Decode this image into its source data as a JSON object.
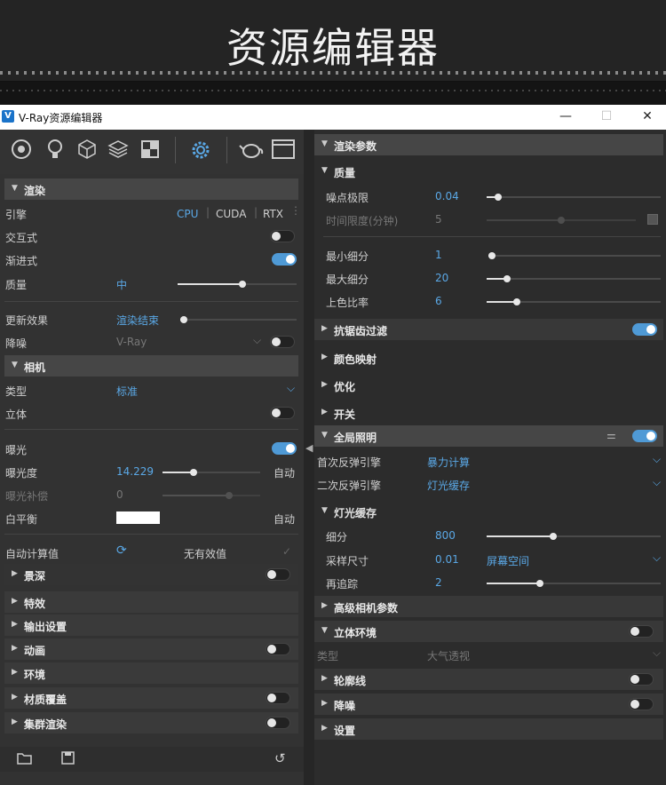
{
  "banner": {
    "title": "资源编辑器"
  },
  "window": {
    "title": "V-Ray资源编辑器",
    "logo": "V",
    "min": "—",
    "max": "☐",
    "close": "✕"
  },
  "toolbar": {
    "icons": [
      "materials-icon",
      "lights-icon",
      "geometry-icon",
      "layers-icon",
      "textures-icon",
      "settings-icon",
      "teapot-render-icon",
      "render-window-icon"
    ]
  },
  "left": {
    "render": {
      "header": "渲染",
      "engine_label": "引擎",
      "cpu": "CPU",
      "cuda": "CUDA",
      "rtx": "RTX",
      "interactive_label": "交互式",
      "progressive_label": "渐进式",
      "quality_label": "质量",
      "quality_value": "中",
      "quality_level": 0.55,
      "update_label": "更新效果",
      "update_value": "渲染结束",
      "update_level": 0.0,
      "denoise_label": "降噪",
      "denoise_value": "V-Ray"
    },
    "camera": {
      "header": "相机",
      "type_label": "类型",
      "type_value": "标准",
      "stereo_label": "立体",
      "exposure_label": "曝光",
      "ev_label": "曝光度",
      "ev_value": "14.229",
      "ev_auto": "自动",
      "ev_level": 0.3,
      "comp_label": "曝光补偿",
      "comp_value": "0",
      "comp_level": 0.7,
      "wb_label": "白平衡",
      "wb_auto": "自动",
      "wb_color": "#ffffff",
      "autocalc_label": "自动计算值",
      "autocalc_status": "无有效值"
    },
    "sections": [
      {
        "label": "景深",
        "toggle": true
      },
      {
        "label": "特效",
        "toggle": false
      },
      {
        "label": "输出设置",
        "toggle": false
      },
      {
        "label": "动画",
        "toggle": true
      },
      {
        "label": "环境",
        "toggle": false
      },
      {
        "label": "材质覆盖",
        "toggle": true
      },
      {
        "label": "集群渲染",
        "toggle": true
      }
    ]
  },
  "right": {
    "header": "渲染参数",
    "quality": {
      "header": "质量",
      "noise_label": "噪点极限",
      "noise_value": "0.04",
      "noise_level": 0.05,
      "time_label": "时间限度(分钟)",
      "time_value": "5",
      "time_level": 0.5,
      "minsub_label": "最小细分",
      "minsub_value": "1",
      "minsub_level": 0.0,
      "maxsub_label": "最大细分",
      "maxsub_value": "20",
      "maxsub_level": 0.1,
      "shade_label": "上色比率",
      "shade_value": "6",
      "shade_level": 0.16
    },
    "aa": "抗锯齿过滤",
    "color_mapping": "颜色映射",
    "optimize": "优化",
    "switches": "开关",
    "gi": {
      "header": "全局照明",
      "primary_label": "首次反弹引擎",
      "primary_value": "暴力计算",
      "secondary_label": "二次反弹引擎",
      "secondary_value": "灯光缓存"
    },
    "lightcache": {
      "header": "灯光缓存",
      "subdiv_label": "细分",
      "subdiv_value": "800",
      "subdiv_level": 0.38,
      "sample_label": "采样尺寸",
      "sample_value": "0.01",
      "sample_mode": "屏幕空间",
      "retrace_label": "再追踪",
      "retrace_value": "2",
      "retrace_level": 0.3
    },
    "adv_camera": "高级相机参数",
    "vol_env": {
      "header": "立体环境",
      "type_label": "类型",
      "type_value": "大气透视"
    },
    "contours": "轮廓线",
    "denoise": "降噪",
    "settings": "设置"
  }
}
